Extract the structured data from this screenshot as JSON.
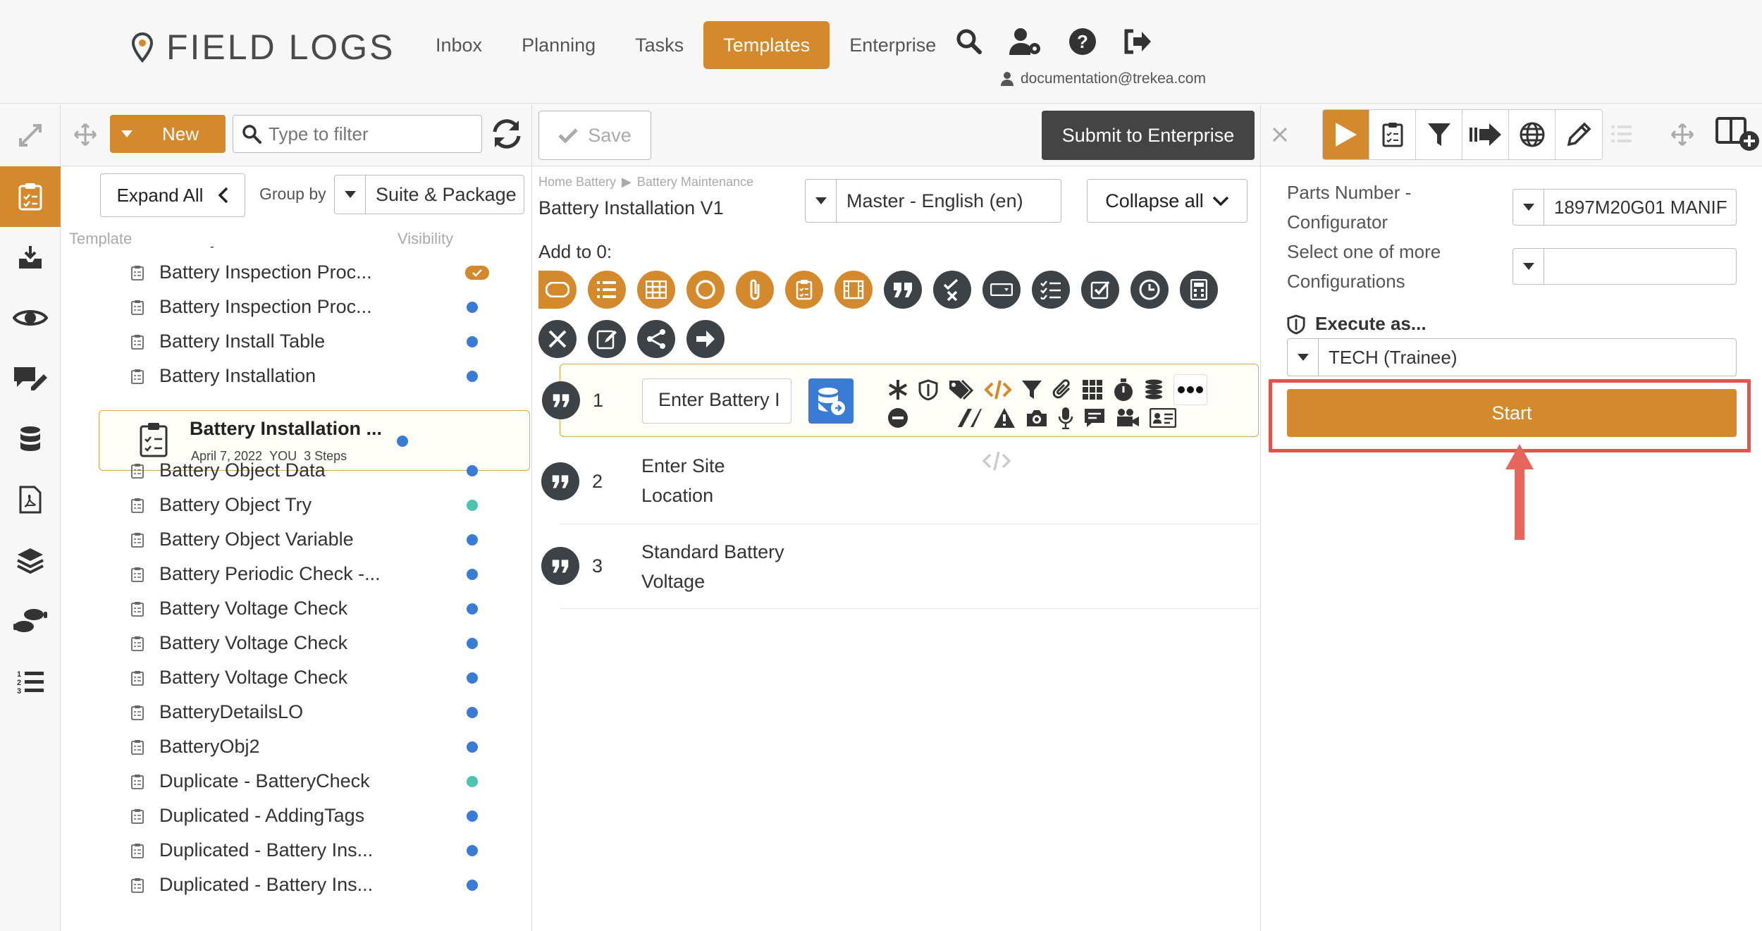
{
  "app": {
    "name": "FIELD LOGS",
    "accent": "#d4892c",
    "dark": "#3d4247",
    "highlight": "#e0564f"
  },
  "nav": {
    "items": [
      "Inbox",
      "Planning",
      "Tasks",
      "Templates",
      "Enterprise"
    ],
    "active": "Templates"
  },
  "header": {
    "icons": [
      "search-icon",
      "user-settings-icon",
      "help-icon",
      "logout-icon"
    ],
    "user_email": "documentation@trekea.com"
  },
  "toolbar": {
    "new_label": "New",
    "filter_placeholder": "Type to filter",
    "save_label": "Save",
    "submit_label": "Submit to Enterprise"
  },
  "left": {
    "expand_all": "Expand All",
    "group_by_label": "Group by",
    "group_by_value": "Suite & Package",
    "col_template": "Template",
    "col_visibility": "Visibility",
    "templates": [
      {
        "name": "Battery Information - LO",
        "vis": "blue"
      },
      {
        "name": "Battery Inspection Proc...",
        "vis": "check"
      },
      {
        "name": "Battery Inspection Proc...",
        "vis": "blue"
      },
      {
        "name": "Battery Install Table",
        "vis": "blue"
      },
      {
        "name": "Battery Installation",
        "vis": "blue"
      },
      {
        "name": "Battery Object Data",
        "vis": "blue"
      },
      {
        "name": "Battery Object Try",
        "vis": "teal"
      },
      {
        "name": "Battery Object Variable",
        "vis": "blue"
      },
      {
        "name": "Battery Periodic Check -...",
        "vis": "blue"
      },
      {
        "name": "Battery Voltage Check",
        "vis": "blue"
      },
      {
        "name": "Battery Voltage Check",
        "vis": "blue"
      },
      {
        "name": "Battery Voltage Check",
        "vis": "blue"
      },
      {
        "name": "BatteryDetailsLO",
        "vis": "blue"
      },
      {
        "name": "BatteryObj2",
        "vis": "blue"
      },
      {
        "name": "Duplicate - BatteryCheck",
        "vis": "teal"
      },
      {
        "name": "Duplicated - AddingTags",
        "vis": "blue"
      },
      {
        "name": "Duplicated - Battery Ins...",
        "vis": "blue"
      },
      {
        "name": "Duplicated - Battery Ins...",
        "vis": "blue"
      }
    ],
    "selected": {
      "name": "Battery Installation ...",
      "date": "April 7, 2022",
      "owner": "YOU",
      "steps": "3 Steps"
    }
  },
  "middle": {
    "breadcrumb": [
      "Home Battery",
      "Battery Maintenance"
    ],
    "title": "Battery Installation V1",
    "language": "Master - English (en)",
    "collapse_label": "Collapse all",
    "add_to_label": "Add to 0:",
    "steps": [
      {
        "num": "1",
        "text": "Enter Battery I"
      },
      {
        "num": "2",
        "text": "Enter Site Location"
      },
      {
        "num": "3",
        "text": "Standard Battery Voltage"
      }
    ]
  },
  "right": {
    "field1_label": "Parts Number - Configurator",
    "field1_value": "1897M20G01 MANIF",
    "field2_label": "Select one of more Configurations",
    "field2_value": "",
    "execute_label": "Execute as...",
    "execute_value": "TECH (Trainee)",
    "start_label": "Start"
  }
}
